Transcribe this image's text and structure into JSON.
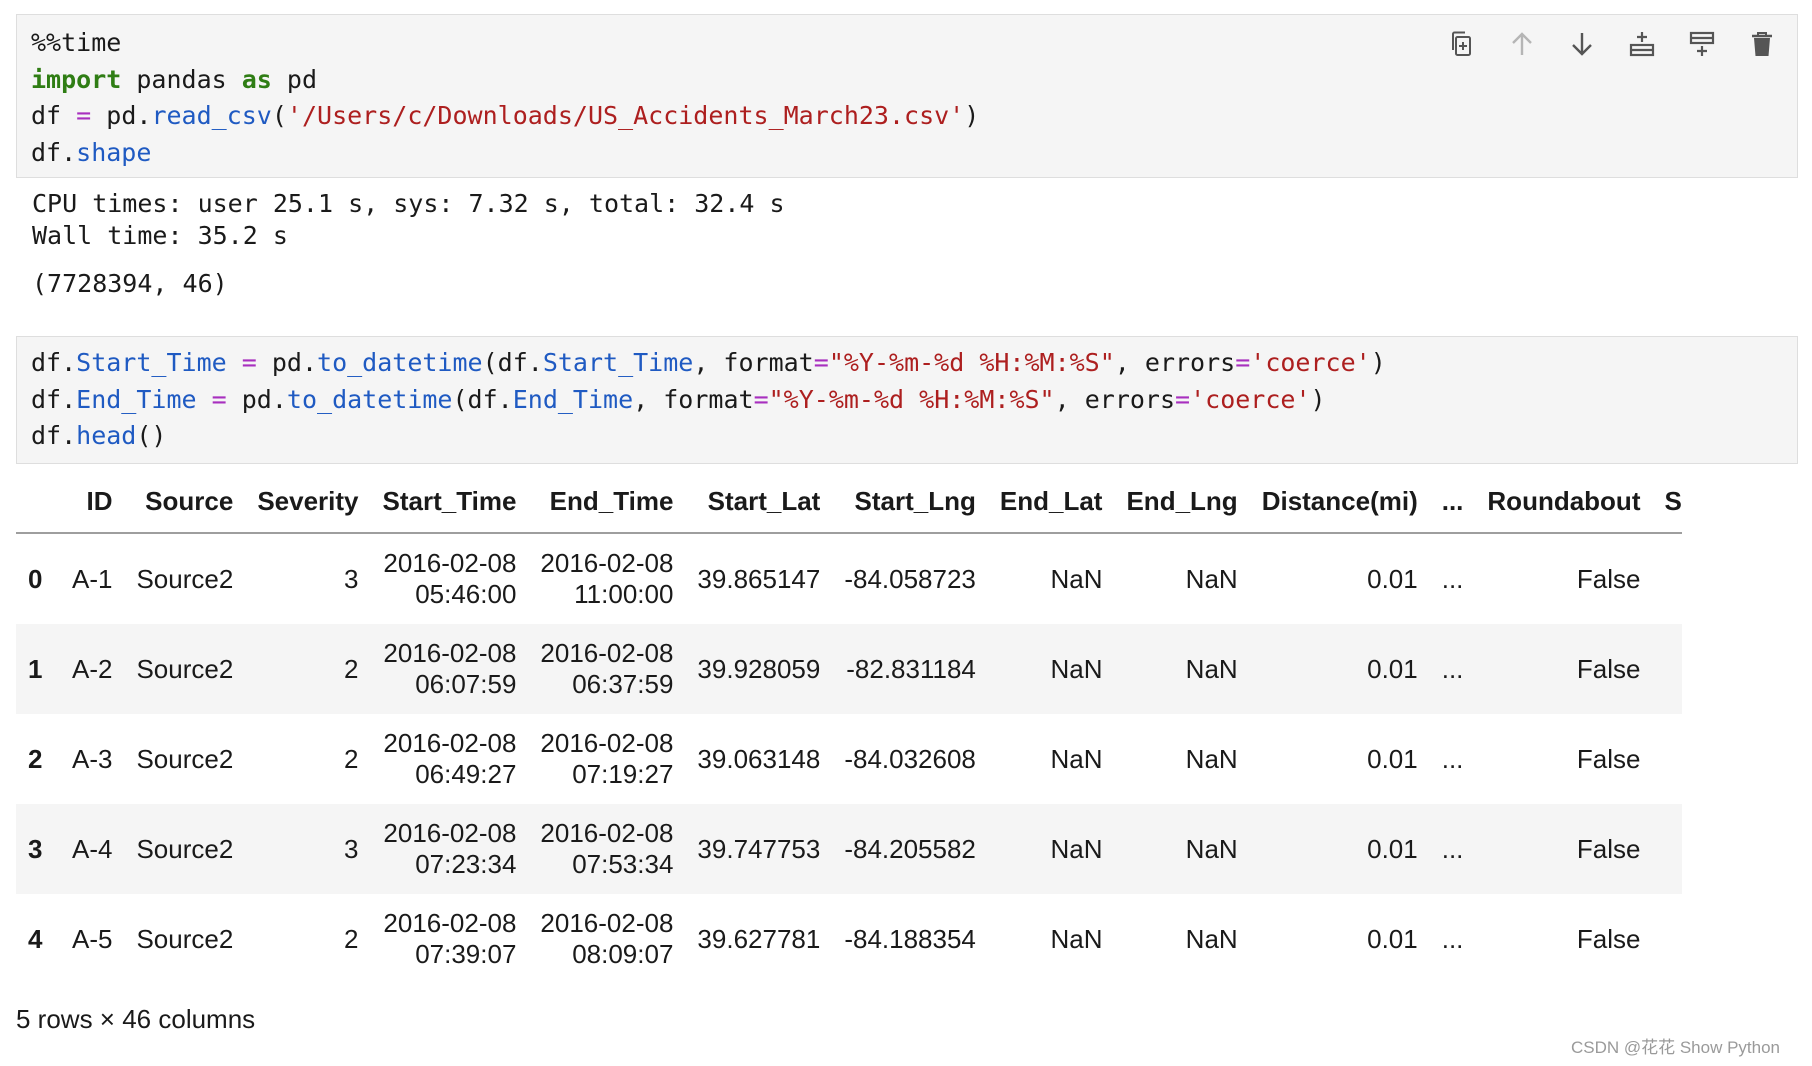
{
  "cell1": {
    "lines": [
      [
        {
          "t": "%%time",
          "c": "plain"
        }
      ],
      [
        {
          "t": "import",
          "c": "kw"
        },
        {
          "t": " pandas ",
          "c": "plain"
        },
        {
          "t": "as",
          "c": "kw"
        },
        {
          "t": " pd",
          "c": "plain"
        }
      ],
      [
        {
          "t": "df ",
          "c": "plain"
        },
        {
          "t": "=",
          "c": "op"
        },
        {
          "t": " pd.",
          "c": "plain"
        },
        {
          "t": "read_csv",
          "c": "attr"
        },
        {
          "t": "(",
          "c": "plain"
        },
        {
          "t": "'/Users/c/Downloads/US_Accidents_March23.csv'",
          "c": "str"
        },
        {
          "t": ")",
          "c": "plain"
        }
      ],
      [
        {
          "t": "df.",
          "c": "plain"
        },
        {
          "t": "shape",
          "c": "attr"
        }
      ]
    ]
  },
  "toolbar": {
    "icons": [
      "copy-cell-icon",
      "move-up-icon",
      "move-down-icon",
      "insert-above-icon",
      "insert-below-icon",
      "delete-icon"
    ]
  },
  "output1": {
    "timing_line1": "CPU times: user 25.1 s, sys: 7.32 s, total: 32.4 s",
    "timing_line2": "Wall time: 35.2 s",
    "shape": "(7728394, 46)"
  },
  "cell2": {
    "lines": [
      [
        {
          "t": "df.",
          "c": "plain"
        },
        {
          "t": "Start_Time",
          "c": "attr"
        },
        {
          "t": " ",
          "c": "plain"
        },
        {
          "t": "=",
          "c": "op"
        },
        {
          "t": " pd.",
          "c": "plain"
        },
        {
          "t": "to_datetime",
          "c": "attr"
        },
        {
          "t": "(df.",
          "c": "plain"
        },
        {
          "t": "Start_Time",
          "c": "attr"
        },
        {
          "t": ", format",
          "c": "plain"
        },
        {
          "t": "=",
          "c": "op"
        },
        {
          "t": "\"%Y-%m-%d %H:%M:%S\"",
          "c": "str"
        },
        {
          "t": ", errors",
          "c": "plain"
        },
        {
          "t": "=",
          "c": "op"
        },
        {
          "t": "'coerce'",
          "c": "str"
        },
        {
          "t": ")",
          "c": "plain"
        }
      ],
      [
        {
          "t": "df.",
          "c": "plain"
        },
        {
          "t": "End_Time",
          "c": "attr"
        },
        {
          "t": " ",
          "c": "plain"
        },
        {
          "t": "=",
          "c": "op"
        },
        {
          "t": " pd.",
          "c": "plain"
        },
        {
          "t": "to_datetime",
          "c": "attr"
        },
        {
          "t": "(df.",
          "c": "plain"
        },
        {
          "t": "End_Time",
          "c": "attr"
        },
        {
          "t": ", format",
          "c": "plain"
        },
        {
          "t": "=",
          "c": "op"
        },
        {
          "t": "\"%Y-%m-%d %H:%M:%S\"",
          "c": "str"
        },
        {
          "t": ", errors",
          "c": "plain"
        },
        {
          "t": "=",
          "c": "op"
        },
        {
          "t": "'coerce'",
          "c": "str"
        },
        {
          "t": ")",
          "c": "plain"
        }
      ],
      [
        {
          "t": "df.",
          "c": "plain"
        },
        {
          "t": "head",
          "c": "attr"
        },
        {
          "t": "()",
          "c": "plain"
        }
      ]
    ]
  },
  "dataframe": {
    "columns": [
      "ID",
      "Source",
      "Severity",
      "Start_Time",
      "End_Time",
      "Start_Lat",
      "Start_Lng",
      "End_Lat",
      "End_Lng",
      "Distance(mi)",
      "...",
      "Roundabout",
      "S"
    ],
    "rows": [
      {
        "index": "0",
        "ID": "A-1",
        "Source": "Source2",
        "Severity": "3",
        "Start_Time": [
          "2016-02-08",
          "05:46:00"
        ],
        "End_Time": [
          "2016-02-08",
          "11:00:00"
        ],
        "Start_Lat": "39.865147",
        "Start_Lng": "-84.058723",
        "End_Lat": "NaN",
        "End_Lng": "NaN",
        "Distance": "0.01",
        "Ellipsis": "...",
        "Roundabout": "False"
      },
      {
        "index": "1",
        "ID": "A-2",
        "Source": "Source2",
        "Severity": "2",
        "Start_Time": [
          "2016-02-08",
          "06:07:59"
        ],
        "End_Time": [
          "2016-02-08",
          "06:37:59"
        ],
        "Start_Lat": "39.928059",
        "Start_Lng": "-82.831184",
        "End_Lat": "NaN",
        "End_Lng": "NaN",
        "Distance": "0.01",
        "Ellipsis": "...",
        "Roundabout": "False"
      },
      {
        "index": "2",
        "ID": "A-3",
        "Source": "Source2",
        "Severity": "2",
        "Start_Time": [
          "2016-02-08",
          "06:49:27"
        ],
        "End_Time": [
          "2016-02-08",
          "07:19:27"
        ],
        "Start_Lat": "39.063148",
        "Start_Lng": "-84.032608",
        "End_Lat": "NaN",
        "End_Lng": "NaN",
        "Distance": "0.01",
        "Ellipsis": "...",
        "Roundabout": "False"
      },
      {
        "index": "3",
        "ID": "A-4",
        "Source": "Source2",
        "Severity": "3",
        "Start_Time": [
          "2016-02-08",
          "07:23:34"
        ],
        "End_Time": [
          "2016-02-08",
          "07:53:34"
        ],
        "Start_Lat": "39.747753",
        "Start_Lng": "-84.205582",
        "End_Lat": "NaN",
        "End_Lng": "NaN",
        "Distance": "0.01",
        "Ellipsis": "...",
        "Roundabout": "False"
      },
      {
        "index": "4",
        "ID": "A-5",
        "Source": "Source2",
        "Severity": "2",
        "Start_Time": [
          "2016-02-08",
          "07:39:07"
        ],
        "End_Time": [
          "2016-02-08",
          "08:09:07"
        ],
        "Start_Lat": "39.627781",
        "Start_Lng": "-84.188354",
        "End_Lat": "NaN",
        "End_Lng": "NaN",
        "Distance": "0.01",
        "Ellipsis": "...",
        "Roundabout": "False"
      }
    ],
    "footer": "5 rows × 46 columns"
  },
  "watermark": "CSDN @花花 Show Python",
  "colors": {
    "keyword": "#2f7d14",
    "attribute": "#1f5ac2",
    "string": "#ad1f1f",
    "operator": "#a82fbf",
    "cell_background": "#f5f5f5"
  }
}
